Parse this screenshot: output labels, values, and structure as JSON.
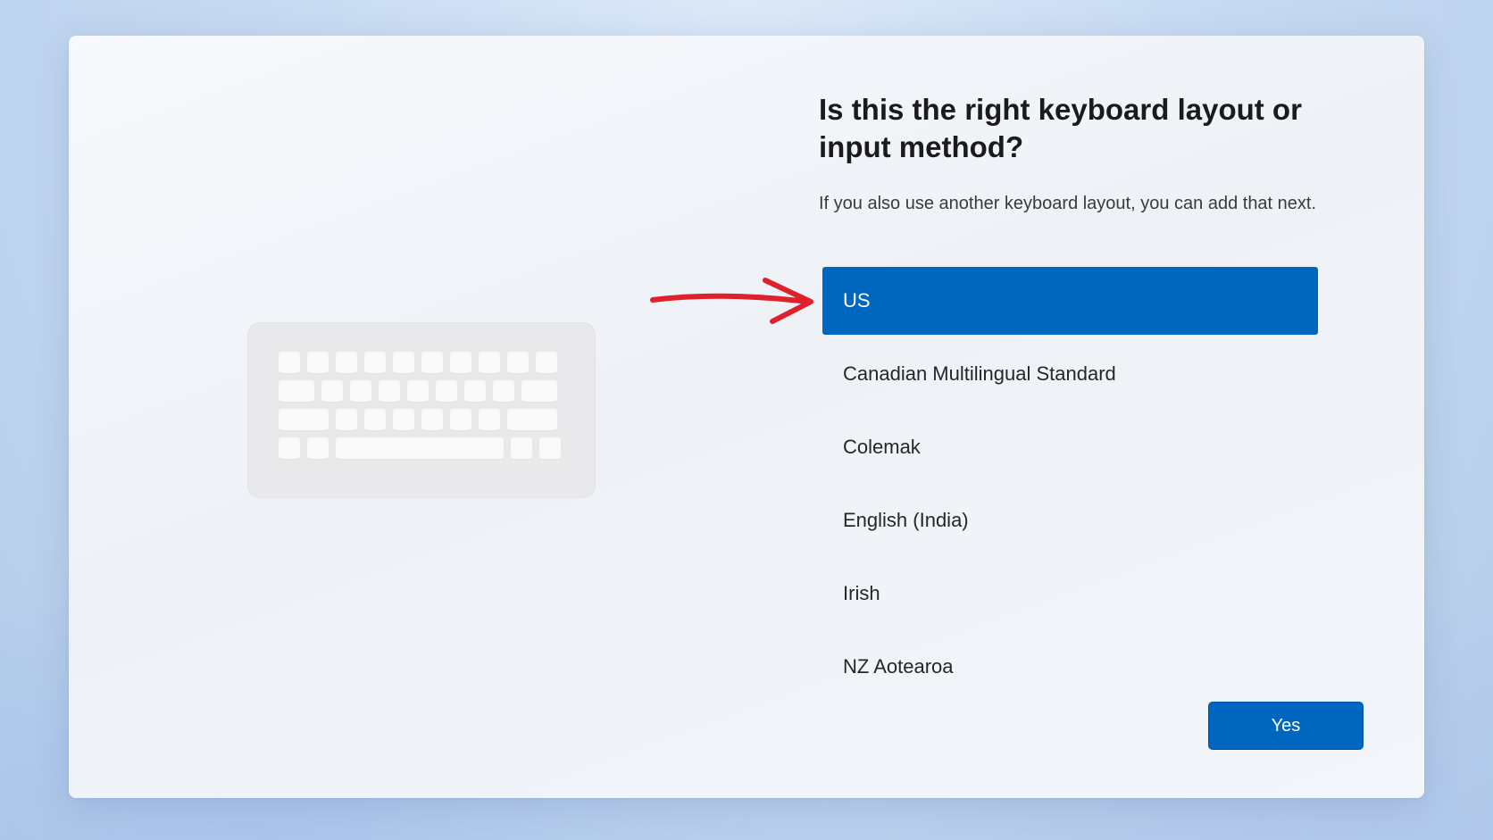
{
  "setup": {
    "title": "Is this the right keyboard layout or input method?",
    "subtitle": "If you also use another keyboard layout, you can add that next.",
    "layouts": [
      {
        "label": "US",
        "selected": true
      },
      {
        "label": "Canadian Multilingual Standard",
        "selected": false
      },
      {
        "label": "Colemak",
        "selected": false
      },
      {
        "label": "English (India)",
        "selected": false
      },
      {
        "label": "Irish",
        "selected": false
      },
      {
        "label": "NZ Aotearoa",
        "selected": false
      }
    ],
    "yes_label": "Yes"
  },
  "icons": {
    "illustration": "keyboard-illustration",
    "annotation": "red-arrow-annotation"
  },
  "colors": {
    "accent": "#0067c0",
    "annotation_red": "#e0202a"
  }
}
